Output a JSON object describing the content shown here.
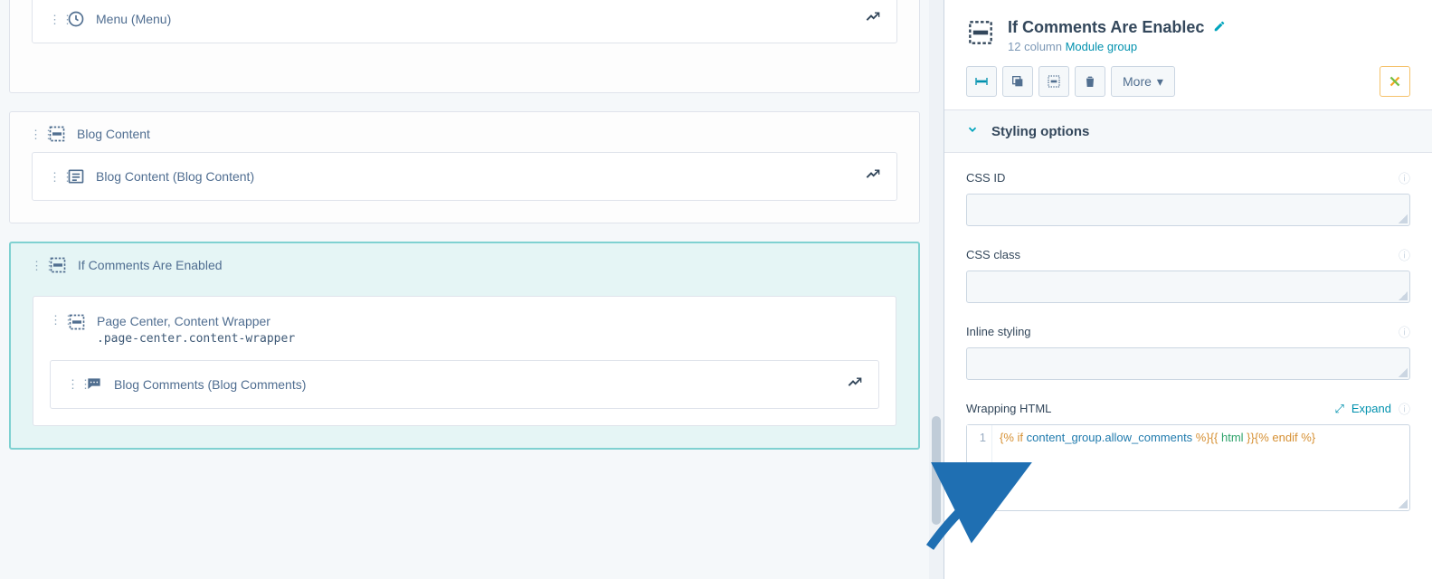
{
  "left": {
    "menu_module": {
      "label": "Menu (Menu)"
    },
    "blog_content_group": {
      "title": "Blog Content",
      "module_label": "Blog Content (Blog Content)"
    },
    "comments_group": {
      "title": "If Comments Are Enabled",
      "wrapper_title": "Page Center, Content Wrapper",
      "wrapper_class": ".page-center.content-wrapper",
      "module_label": "Blog Comments (Blog Comments)"
    }
  },
  "right": {
    "title": "If Comments Are Enablec",
    "subtitle_prefix": "12 column ",
    "subtitle_link": "Module group",
    "more_label": "More",
    "section_title": "Styling options",
    "fields": {
      "css_id": {
        "label": "CSS ID",
        "value": ""
      },
      "css_class": {
        "label": "CSS class",
        "value": ""
      },
      "inline_styling": {
        "label": "Inline styling",
        "value": ""
      },
      "wrapping_html": {
        "label": "Wrapping HTML",
        "expand_label": "Expand",
        "line_no": "1",
        "code_parts": {
          "p1": "{% ",
          "p2": "if",
          "p3": " content_group.allow_comments ",
          "p4": "%}",
          "p5": "{{ ",
          "p6": "html",
          "p7": " }}",
          "p8": "{% ",
          "p9": "endif",
          "p10": " %}"
        }
      }
    }
  }
}
